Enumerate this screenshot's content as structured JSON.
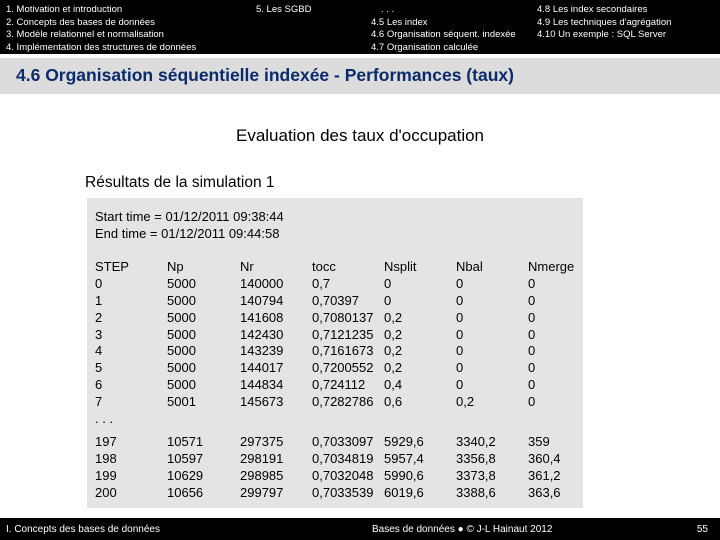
{
  "nav": {
    "left_items": [
      "1. Motivation et introduction",
      "2. Concepts des bases de données",
      "3. Modèle relationnel et normalisation",
      "4. Implémentation des structures de données"
    ],
    "sgbd": "5. Les SGBD",
    "mid_items": [
      ". . .",
      "4.5 Les index",
      "4.6 Organisation séquent. indexée",
      "4.7 Organisation calculée"
    ],
    "right_items": [
      "4.8 Les index secondaires",
      "4.9 Les techniques d'agrégation",
      "4.10 Un exemple : SQL Server"
    ]
  },
  "slide_title": "4.6 Organisation séquentielle indexée - Performances (taux)",
  "subtitle": "Evaluation des taux d'occupation",
  "results_heading": "Résultats de la simulation 1",
  "start_time": "Start time = 01/12/2011 09:38:44",
  "end_time": "End time = 01/12/2011 09:44:58",
  "table": {
    "columns": [
      {
        "header": "STEP",
        "block1": [
          "0",
          "1",
          "2",
          "3",
          "4",
          "5",
          "6",
          "7",
          ". . ."
        ],
        "block2": [
          "197",
          "198",
          "199",
          "200"
        ]
      },
      {
        "header": "Np",
        "block1": [
          "5000",
          "5000",
          "5000",
          "5000",
          "5000",
          "5000",
          "5000",
          "5001"
        ],
        "block2": [
          "10571",
          "10597",
          "10629",
          "10656"
        ]
      },
      {
        "header": "Nr",
        "block1": [
          "140000",
          "140794",
          "141608",
          "142430",
          "143239",
          "144017",
          "144834",
          "145673"
        ],
        "block2": [
          "297375",
          "298191",
          "298985",
          "299797"
        ]
      },
      {
        "header": "tocc",
        "block1": [
          "0,7",
          "0,70397",
          "0,7080137",
          "0,7121235",
          "0,7161673",
          "0,7200552",
          "0,724112",
          "0,7282786"
        ],
        "block2": [
          "0,7033097",
          "0,7034819",
          "0,7032048",
          "0,7033539"
        ]
      },
      {
        "header": "Nsplit",
        "block1": [
          "0",
          "0",
          "0,2",
          "0,2",
          "0,2",
          "0,2",
          "0,4",
          "0,6"
        ],
        "block2": [
          "5929,6",
          "5957,4",
          "5990,6",
          "6019,6"
        ]
      },
      {
        "header": "Nbal",
        "block1": [
          "0",
          "0",
          "0",
          "0",
          "0",
          "0",
          "0",
          "0,2"
        ],
        "block2": [
          "3340,2",
          "3356,8",
          "3373,8",
          "3388,6"
        ]
      },
      {
        "header": "Nmerge",
        "block1": [
          "0",
          "0",
          "0",
          "0",
          "0",
          "0",
          "0",
          "0"
        ],
        "block2": [
          "359",
          "360,4",
          "361,2",
          "363,6"
        ]
      }
    ]
  },
  "footer": {
    "left": "I. Concepts des bases de données",
    "center": "Bases de données  ●  © J-L Hainaut 2012",
    "page": "55"
  }
}
